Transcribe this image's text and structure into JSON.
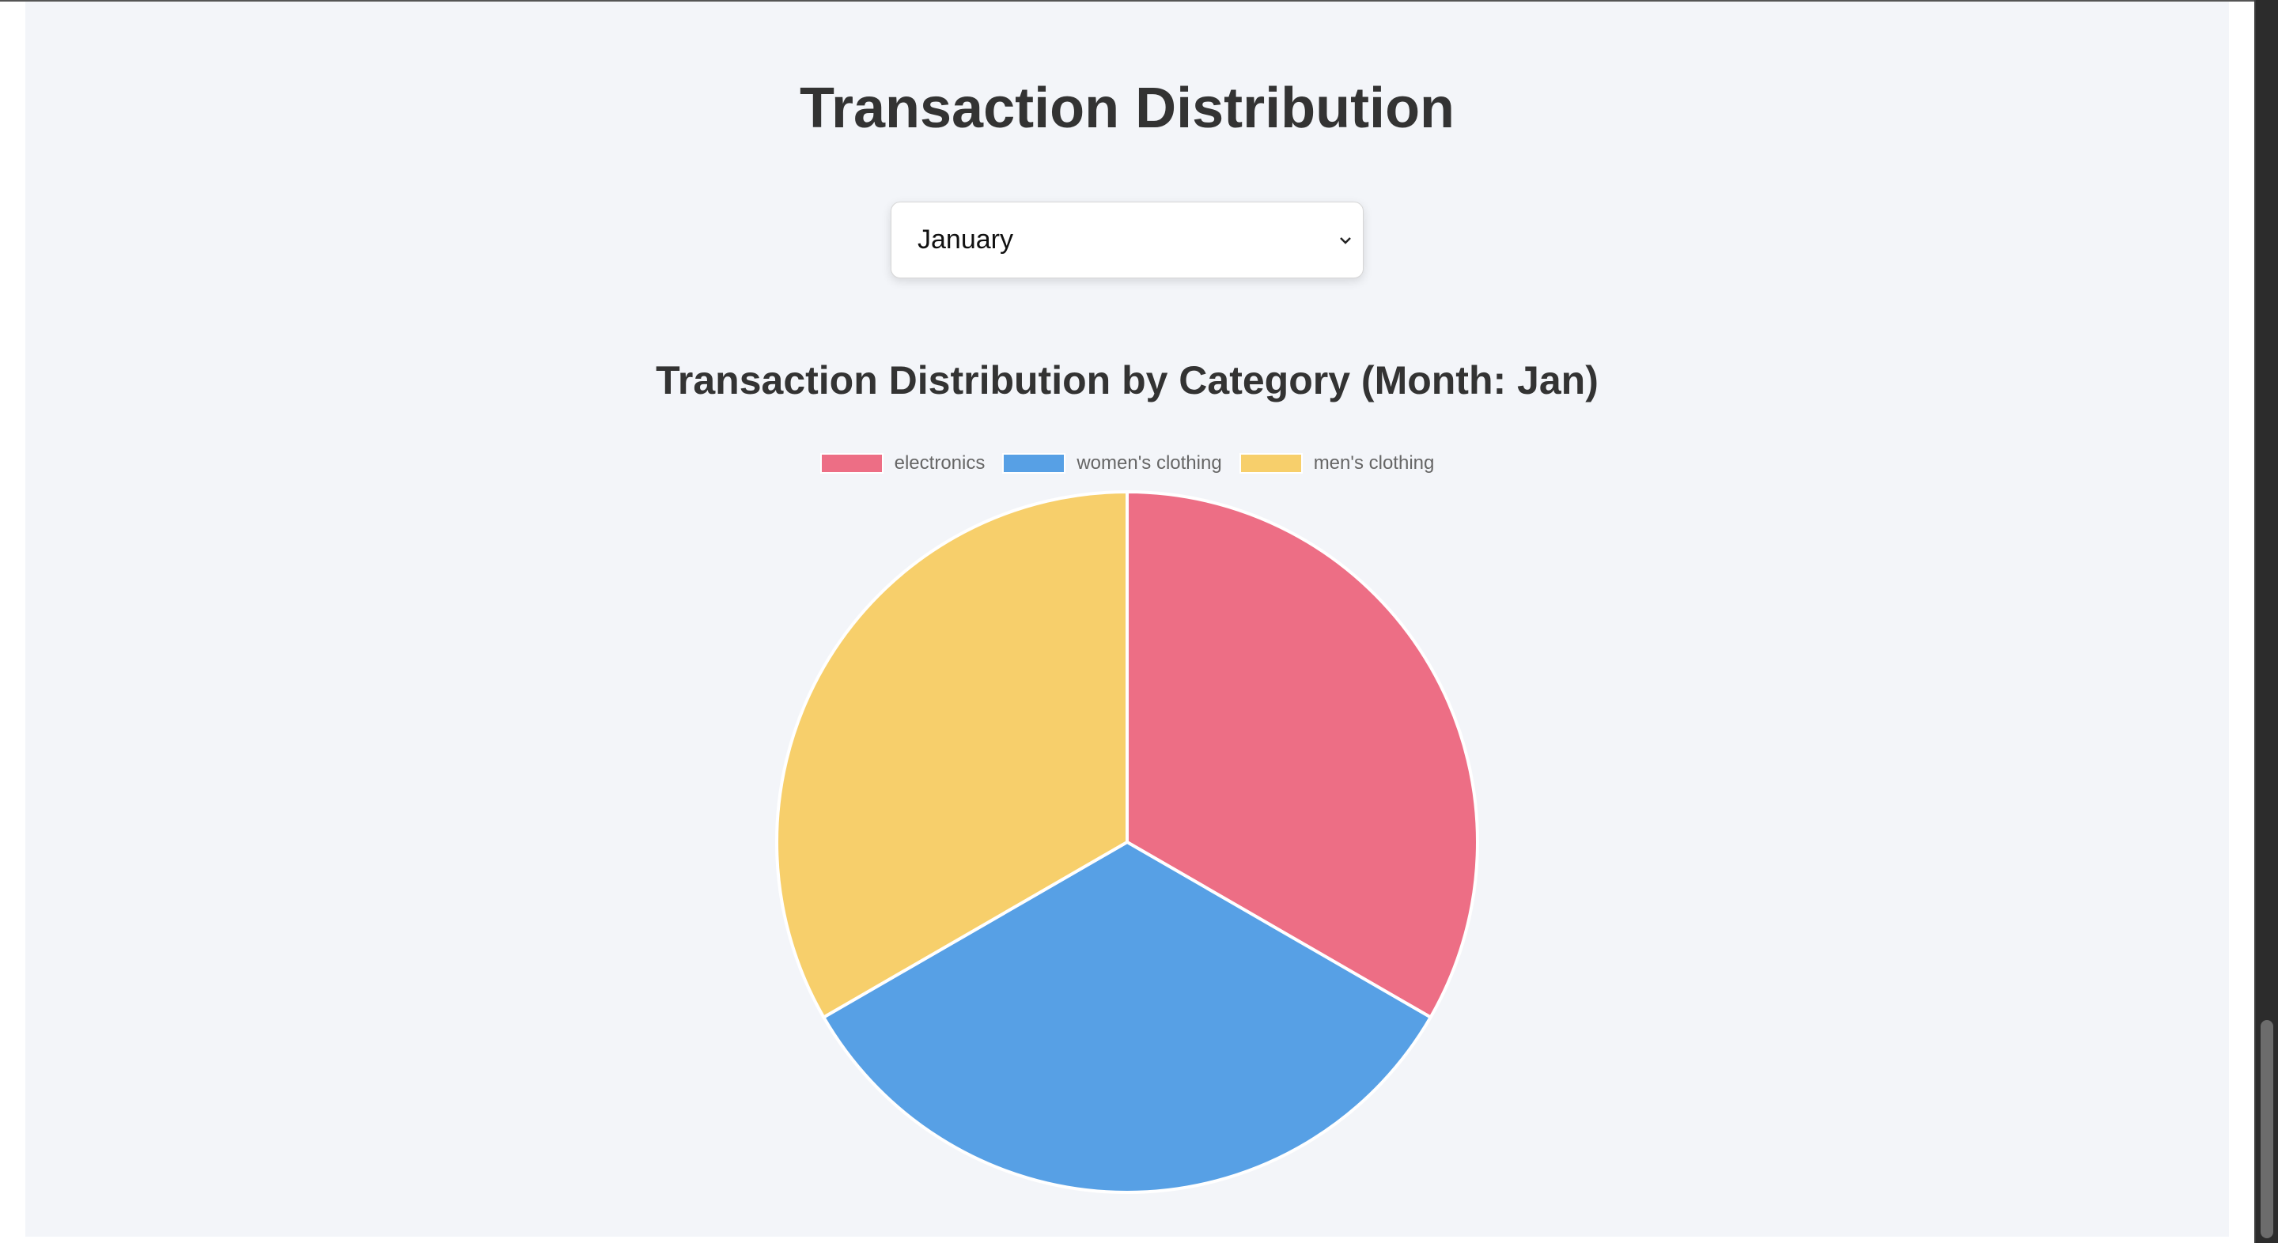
{
  "header": {
    "title": "Transaction Distribution"
  },
  "month_select": {
    "selected": "January"
  },
  "chart_data": {
    "type": "pie",
    "title": "Transaction Distribution by Category (Month: Jan)",
    "categories": [
      "electronics",
      "women's clothing",
      "men's clothing"
    ],
    "values": [
      1,
      1,
      1
    ],
    "colors": [
      "#ed6e85",
      "#57a0e5",
      "#f7cf6b"
    ],
    "legend_position": "top"
  }
}
